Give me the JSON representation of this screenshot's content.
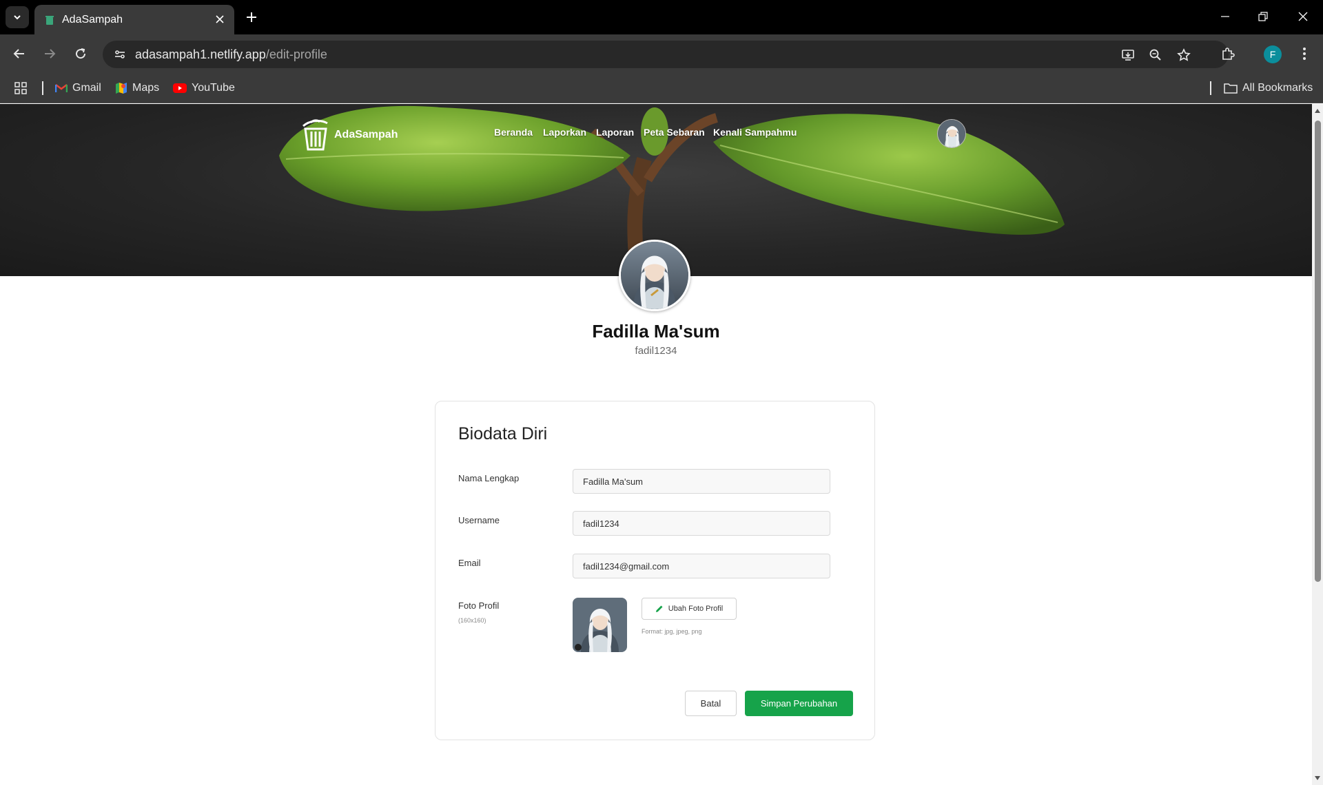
{
  "browser": {
    "tab_title": "AdaSampah",
    "url_host": "adasampah1.netlify.app",
    "url_path": "/edit-profile",
    "profile_initial": "F",
    "bookmarks": [
      {
        "label": "Gmail",
        "icon": "gmail-icon"
      },
      {
        "label": "Maps",
        "icon": "maps-icon"
      },
      {
        "label": "YouTube",
        "icon": "youtube-icon"
      }
    ],
    "all_bookmarks": "All Bookmarks"
  },
  "site": {
    "brand": "AdaSampah",
    "nav": [
      "Beranda",
      "Laporkan",
      "Laporan",
      "Peta Sebaran",
      "Kenali Sampahmu"
    ]
  },
  "profile": {
    "name": "Fadilla Ma'sum",
    "username": "fadil1234"
  },
  "form": {
    "title": "Biodata Diri",
    "fields": [
      {
        "label": "Nama Lengkap",
        "value": "Fadilla Ma'sum"
      },
      {
        "label": "Username",
        "value": "fadil1234"
      },
      {
        "label": "Email",
        "value": "fadil1234@gmail.com"
      }
    ],
    "photo": {
      "label": "Foto Profil",
      "sub": "(160x160)",
      "change_button": "Ubah Foto Profil",
      "format_hint": "Format: jpg, jpeg, png"
    },
    "cancel_button": "Batal",
    "save_button": "Simpan Perubahan"
  },
  "colors": {
    "accent_green": "#16a34a",
    "chrome_dark": "#3a3a3a",
    "profile_badge": "#0b8e9c"
  }
}
